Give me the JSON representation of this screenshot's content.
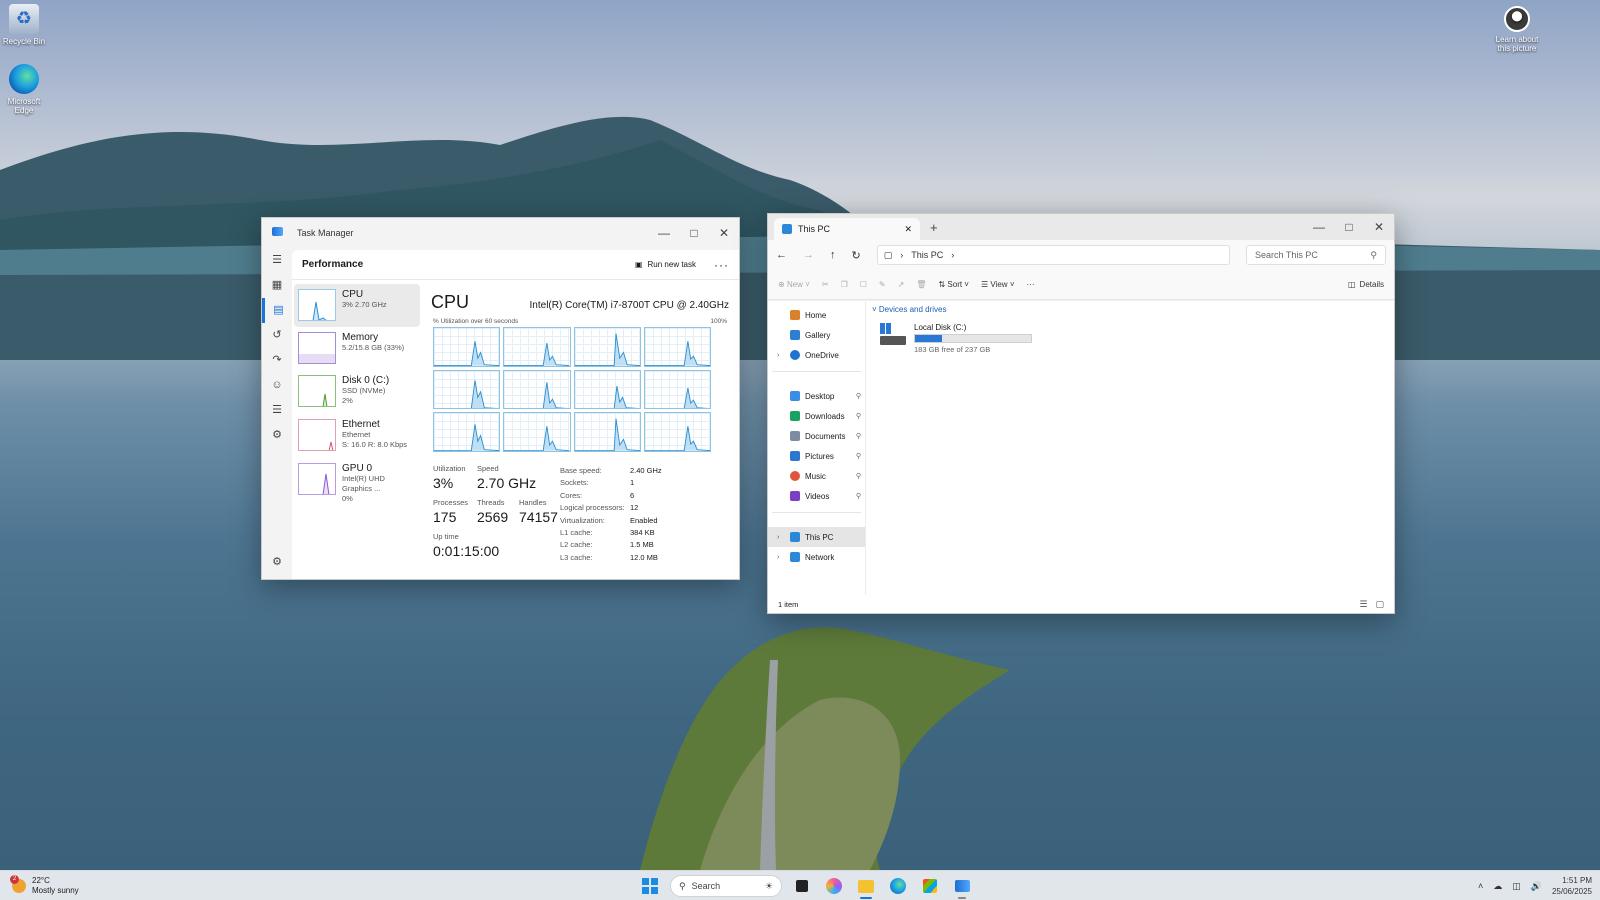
{
  "desktop": {
    "icons": [
      {
        "label": "Recycle Bin",
        "icon": "recycle-bin-icon"
      },
      {
        "label": "Microsoft Edge",
        "icon": "edge-icon"
      },
      {
        "label": "Learn about this picture",
        "icon": "learn-picture-icon"
      }
    ]
  },
  "taskmanager": {
    "title": "Task Manager",
    "page": "Performance",
    "run_new_task": "Run new task",
    "items": [
      {
        "name": "CPU",
        "sub1": "3% 2.70 GHz",
        "sub2": ""
      },
      {
        "name": "Memory",
        "sub1": "5.2/15.8 GB (33%)",
        "sub2": ""
      },
      {
        "name": "Disk 0 (C:)",
        "sub1": "SSD (NVMe)",
        "sub2": "2%"
      },
      {
        "name": "Ethernet",
        "sub1": "Ethernet",
        "sub2": "S: 16.0 R: 8.0 Kbps"
      },
      {
        "name": "GPU 0",
        "sub1": "Intel(R) UHD Graphics ...",
        "sub2": "0%"
      }
    ],
    "detail": {
      "title": "CPU",
      "model": "Intel(R) Core(TM) i7-8700T CPU @ 2.40GHz",
      "graph_caption": "% Utilization over 60 seconds",
      "graph_max": "100%",
      "utilization_label": "Utilization",
      "utilization": "3%",
      "speed_label": "Speed",
      "speed": "2.70 GHz",
      "processes_label": "Processes",
      "processes": "175",
      "threads_label": "Threads",
      "threads": "2569",
      "handles_label": "Handles",
      "handles": "74157",
      "uptime_label": "Up time",
      "uptime": "0:01:15:00",
      "specs": [
        {
          "k": "Base speed:",
          "v": "2.40 GHz"
        },
        {
          "k": "Sockets:",
          "v": "1"
        },
        {
          "k": "Cores:",
          "v": "6"
        },
        {
          "k": "Logical processors:",
          "v": "12"
        },
        {
          "k": "Virtualization:",
          "v": "Enabled"
        },
        {
          "k": "L1 cache:",
          "v": "384 KB"
        },
        {
          "k": "L2 cache:",
          "v": "1.5 MB"
        },
        {
          "k": "L3 cache:",
          "v": "12.0 MB"
        }
      ]
    }
  },
  "explorer": {
    "tab_title": "This PC",
    "breadcrumb": "This PC",
    "search_placeholder": "Search This PC",
    "cmd": {
      "new": "New",
      "sort": "Sort",
      "view": "View",
      "details": "Details"
    },
    "nav": [
      {
        "label": "Home",
        "color": "#d9822b"
      },
      {
        "label": "Gallery",
        "color": "#2d7dd2"
      },
      {
        "label": "OneDrive",
        "color": "#1f74d0"
      },
      {
        "label": "Desktop",
        "color": "#3a8ee6"
      },
      {
        "label": "Downloads",
        "color": "#1aa260"
      },
      {
        "label": "Documents",
        "color": "#7d8ca3"
      },
      {
        "label": "Pictures",
        "color": "#2b78d0"
      },
      {
        "label": "Music",
        "color": "#e0533d"
      },
      {
        "label": "Videos",
        "color": "#7a3fc4"
      },
      {
        "label": "This PC",
        "color": "#2b88d8"
      },
      {
        "label": "Network",
        "color": "#2b88d8"
      }
    ],
    "group": "Devices and drives",
    "drive": {
      "name": "Local Disk (C:)",
      "free": "183 GB free of 237 GB",
      "used_fraction": 0.23
    },
    "status": "1 item"
  },
  "taskbar": {
    "temp": "22°C",
    "condition": "Mostly sunny",
    "badge": "2",
    "search": "Search",
    "time": "1:51 PM",
    "date": "25/06/2025"
  }
}
